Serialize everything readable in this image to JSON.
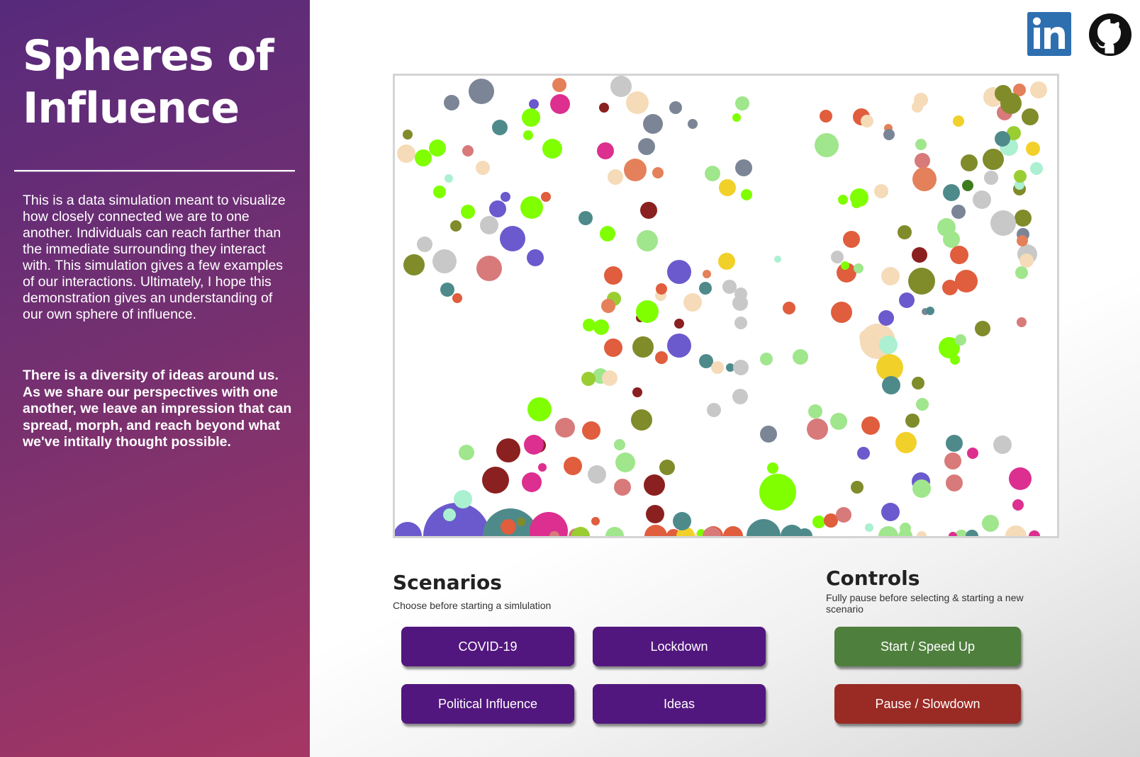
{
  "sidebar": {
    "title": "Spheres of Influence",
    "intro": "This is a data simulation meant to visualize how closely connected we are to one another. Individuals can reach farther than the immediate surrounding they interact with. This simulation gives a few examples of our interactions. Ultimately, I hope this demonstration gives an understanding of our own sphere of influence.",
    "emphasis": "There is a diversity of ideas around us. As we share our perspectives with one another, we leave an impression that can spread, morph, and reach beyond what we've intitally thought possible."
  },
  "social": {
    "linkedin_icon": "linkedin-icon",
    "github_icon": "github-icon",
    "linkedin_color": "#2e6fb0"
  },
  "scenarios": {
    "title": "Scenarios",
    "subtitle": "Choose before starting a simlulation",
    "buttons": [
      "COVID-19",
      "Lockdown",
      "Political Influence",
      "Ideas"
    ]
  },
  "controls": {
    "title": "Controls",
    "subtitle": "Fully pause before selecting & starting a new scenario",
    "start_label": "Start / Speed Up",
    "pause_label": "Pause / Slowdown"
  },
  "colors": {
    "sidebar_gradient": [
      "#572a7c",
      "#a53663"
    ],
    "scenario_button": "#52177e",
    "start_button": "#4f7f3d",
    "pause_button": "#9a2a24"
  },
  "simulation": {
    "palette": [
      "#6a5acd",
      "#4f8a8b",
      "#e05d3d",
      "#dc2f8f",
      "#9acd32",
      "#7fff00",
      "#a0e68c",
      "#8b2020",
      "#3e7a1e",
      "#808b2a",
      "#d87a7a",
      "#c8c8c8",
      "#f5dbb8",
      "#f2d02a",
      "#e4805a",
      "#7b8596",
      "#aaf0d1"
    ]
  }
}
